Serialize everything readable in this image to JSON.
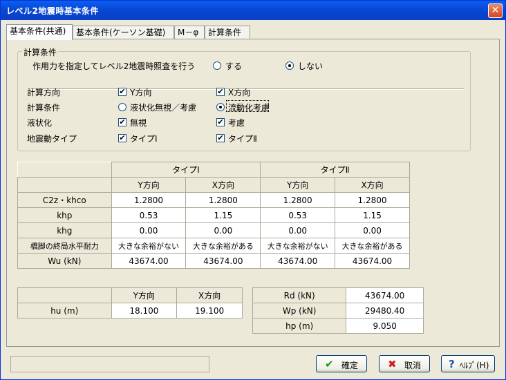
{
  "window": {
    "title": "レベル2地震時基本条件",
    "close_label": "✕"
  },
  "tabs": [
    "基本条件(共通)",
    "基本条件(ケーソン基礎)",
    "M－φ",
    "計算条件"
  ],
  "calc_group": {
    "legend": "計算条件",
    "apply_label": "作用力を指定してレベル2地震時照査を行う",
    "apply_yes": "する",
    "apply_no": "しない",
    "rows": [
      {
        "label": "計算方向",
        "opt1": "Y方向",
        "opt2": "X方向"
      },
      {
        "label": "計算条件",
        "opt1": "液状化無視／考慮",
        "opt2": "流動化考慮"
      },
      {
        "label": "液状化",
        "opt1": "無視",
        "opt2": "考慮"
      },
      {
        "label": "地震動タイプ",
        "opt1": "タイプⅠ",
        "opt2": "タイプⅡ"
      }
    ]
  },
  "main_table": {
    "groups": [
      "タイプⅠ",
      "タイプⅡ"
    ],
    "cols": [
      "Y方向",
      "X方向",
      "Y方向",
      "X方向"
    ],
    "rows": [
      {
        "label": "C2z・khco",
        "v": [
          "1.2800",
          "1.2800",
          "1.2800",
          "1.2800"
        ]
      },
      {
        "label": "khp",
        "v": [
          "0.53",
          "1.15",
          "0.53",
          "1.15"
        ]
      },
      {
        "label": "khg",
        "v": [
          "0.00",
          "0.00",
          "0.00",
          "0.00"
        ]
      },
      {
        "label": "橋脚の終局水平耐力",
        "v": [
          "大きな余裕がない",
          "大きな余裕がある",
          "大きな余裕がない",
          "大きな余裕がある"
        ]
      },
      {
        "label": "Wu (kN)",
        "v": [
          "43674.00",
          "43674.00",
          "43674.00",
          "43674.00"
        ]
      }
    ]
  },
  "hu_table": {
    "cols": [
      "Y方向",
      "X方向"
    ],
    "label": "hu (m)",
    "v": [
      "18.100",
      "19.100"
    ]
  },
  "r_table": {
    "rows": [
      {
        "label": "Rd (kN)",
        "v": "43674.00"
      },
      {
        "label": "Wp (kN)",
        "v": "29480.40"
      },
      {
        "label": "hp (m)",
        "v": "9.050"
      }
    ]
  },
  "buttons": {
    "ok": "確定",
    "cancel": "取消",
    "help": "ﾍﾙﾌﾟ(H)"
  }
}
